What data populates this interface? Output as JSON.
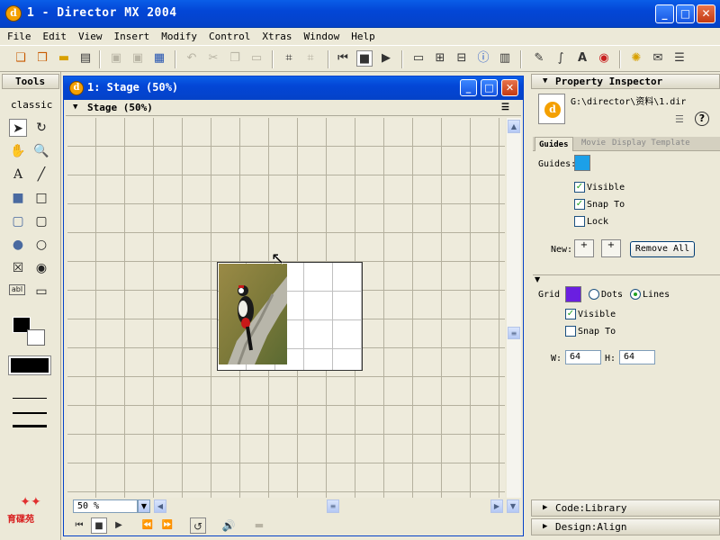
{
  "app": {
    "title": "1 - Director MX 2004",
    "icon": "director-icon"
  },
  "window_buttons": {
    "minimize": "_",
    "maximize": "□",
    "close": "✕"
  },
  "menu": [
    "File",
    "Edit",
    "View",
    "Insert",
    "Modify",
    "Control",
    "Xtras",
    "Window",
    "Help"
  ],
  "tools": {
    "title": "Tools",
    "mode": "classic",
    "logo_text": "育碟苑"
  },
  "stage": {
    "window_title": "1: Stage (50%)",
    "panel_title": "Stage (50%)",
    "zoom": "50 %"
  },
  "property_inspector": {
    "title": "Property Inspector",
    "path": "G:\\director\\资料\\1.dir",
    "tabs": [
      "Guides",
      "Movie",
      "Display Template"
    ],
    "guides": {
      "label": "Guides:",
      "visible": "Visible",
      "snap_to": "Snap To",
      "lock": "Lock",
      "new_label": "New:",
      "remove_all": "Remove All",
      "color": "#1ca0e8",
      "visible_checked": true,
      "snap_checked": true,
      "lock_checked": false
    },
    "grid": {
      "label": "Grid",
      "dots": "Dots",
      "lines": "Lines",
      "visible": "Visible",
      "snap_to": "Snap To",
      "w_label": "W:",
      "w_value": "64",
      "h_label": "H:",
      "h_value": "64",
      "color": "#6a1fe0",
      "lines_selected": true,
      "visible_checked": true,
      "snap_checked": false
    },
    "collapsed_panels": [
      "Code:Library",
      "Design:Align"
    ]
  },
  "colors": {
    "title_bar": "#0346d6",
    "face": "#ece9d8",
    "accent_check": "#21a121"
  }
}
